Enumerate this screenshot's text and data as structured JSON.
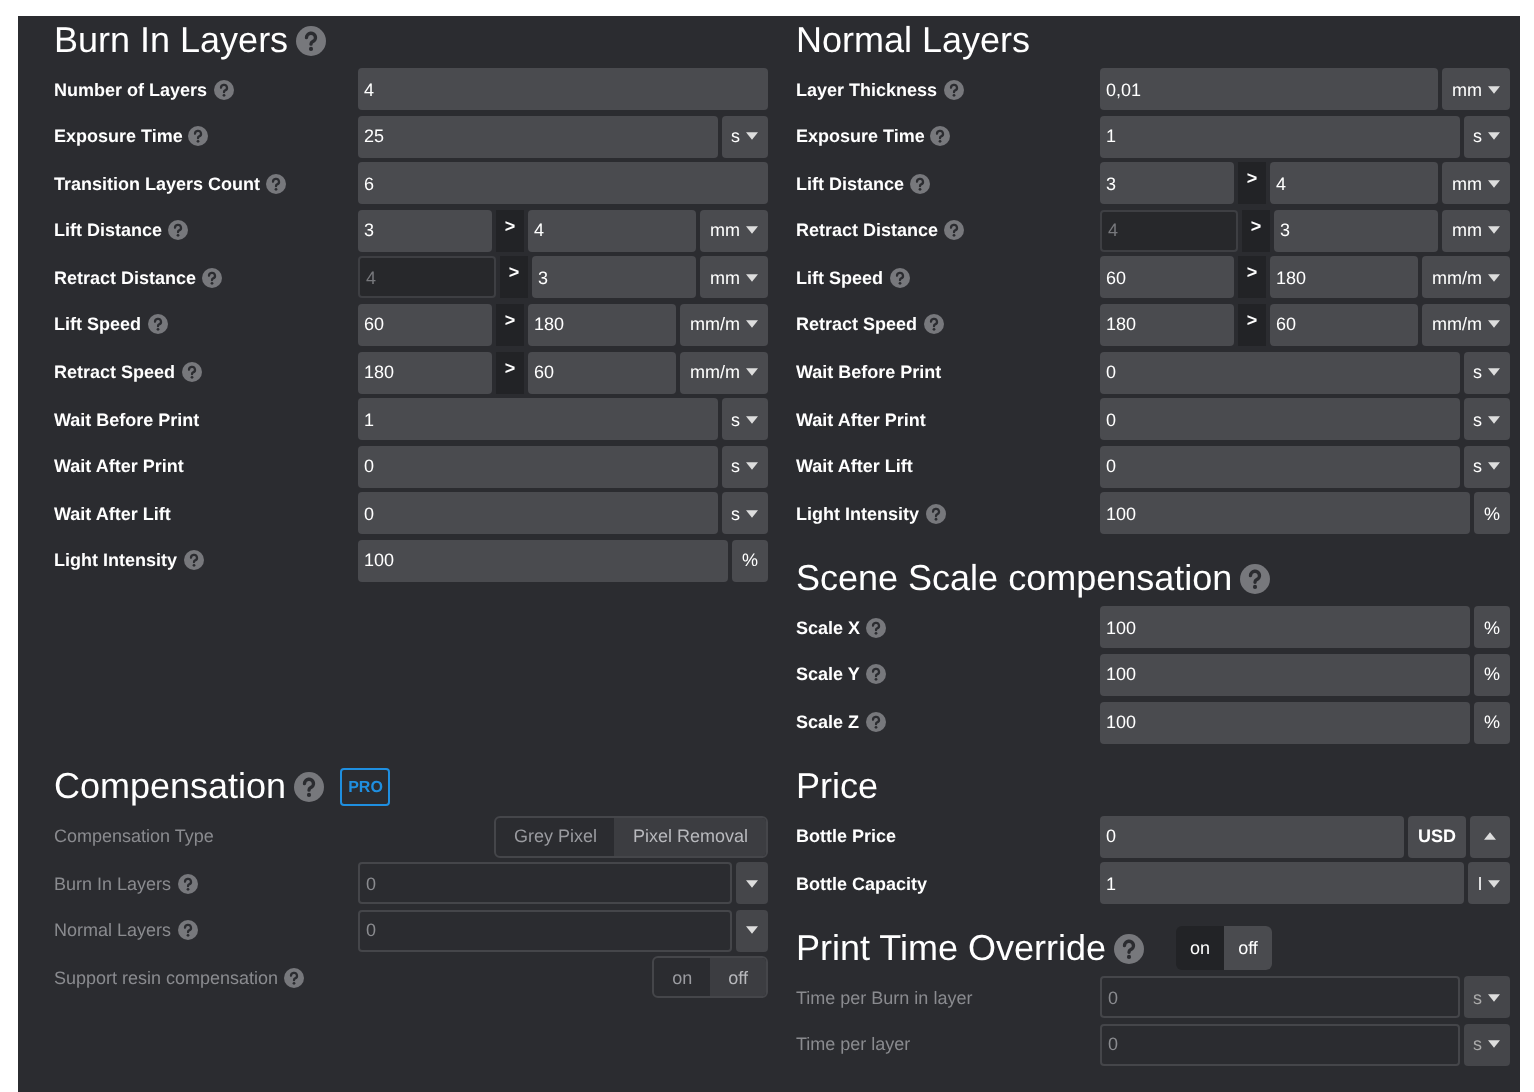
{
  "layout": [
    {
      "left": [
        {
          "title": "Burn In Layers",
          "help": true,
          "rows": [
            {
              "kind": "field",
              "label": "Number of Layers",
              "help": true,
              "value": "4"
            },
            {
              "kind": "field",
              "label": "Exposure Time",
              "help": true,
              "value": "25",
              "unit": "s",
              "unit_menu": true
            },
            {
              "kind": "field",
              "label": "Transition Layers Count",
              "help": true,
              "value": "6"
            },
            {
              "kind": "range",
              "label": "Lift Distance",
              "help": true,
              "from": "3",
              "sep": ">",
              "to": "4",
              "unit": "mm",
              "unit_menu": true
            },
            {
              "kind": "range",
              "label": "Retract Distance",
              "help": true,
              "from": "4",
              "from_disabled": true,
              "sep": ">",
              "to": "3",
              "unit": "mm",
              "unit_menu": true
            },
            {
              "kind": "range",
              "label": "Lift Speed",
              "help": true,
              "from": "60",
              "sep": ">",
              "to": "180",
              "unit": "mm/m",
              "unit_menu": true
            },
            {
              "kind": "range",
              "label": "Retract Speed",
              "help": true,
              "from": "180",
              "sep": ">",
              "to": "60",
              "unit": "mm/m",
              "unit_menu": true
            },
            {
              "kind": "field",
              "label": "Wait Before Print",
              "value": "1",
              "unit": "s",
              "unit_menu": true
            },
            {
              "kind": "field",
              "label": "Wait After Print",
              "value": "0",
              "unit": "s",
              "unit_menu": true
            },
            {
              "kind": "field",
              "label": "Wait After Lift",
              "value": "0",
              "unit": "s",
              "unit_menu": true
            },
            {
              "kind": "field",
              "label": "Light Intensity",
              "help": true,
              "value": "100",
              "unit": "%"
            }
          ]
        }
      ],
      "right": [
        {
          "title": "Normal Layers",
          "rows": [
            {
              "kind": "field",
              "label": "Layer Thickness",
              "help": true,
              "value": "0,01",
              "unit": "mm",
              "unit_menu": true
            },
            {
              "kind": "field",
              "label": "Exposure Time",
              "help": true,
              "value": "1",
              "unit": "s",
              "unit_menu": true
            },
            {
              "kind": "range",
              "label": "Lift Distance",
              "help": true,
              "from": "3",
              "sep": ">",
              "to": "4",
              "unit": "mm",
              "unit_menu": true
            },
            {
              "kind": "range",
              "label": "Retract Distance",
              "help": true,
              "from": "4",
              "from_disabled": true,
              "sep": ">",
              "to": "3",
              "unit": "mm",
              "unit_menu": true
            },
            {
              "kind": "range",
              "label": "Lift Speed",
              "help": true,
              "from": "60",
              "sep": ">",
              "to": "180",
              "unit": "mm/m",
              "unit_menu": true
            },
            {
              "kind": "range",
              "label": "Retract Speed",
              "help": true,
              "from": "180",
              "sep": ">",
              "to": "60",
              "unit": "mm/m",
              "unit_menu": true
            },
            {
              "kind": "field",
              "label": "Wait Before Print",
              "value": "0",
              "unit": "s",
              "unit_menu": true
            },
            {
              "kind": "field",
              "label": "Wait After Print",
              "value": "0",
              "unit": "s",
              "unit_menu": true
            },
            {
              "kind": "field",
              "label": "Wait After Lift",
              "value": "0",
              "unit": "s",
              "unit_menu": true
            },
            {
              "kind": "field",
              "label": "Light Intensity",
              "help": true,
              "value": "100",
              "unit": "%"
            }
          ]
        },
        {
          "title": "Scene Scale compensation",
          "help": true,
          "rows": [
            {
              "kind": "field",
              "label": "Scale X",
              "help": true,
              "value": "100",
              "unit": "%"
            },
            {
              "kind": "field",
              "label": "Scale Y",
              "help": true,
              "value": "100",
              "unit": "%"
            },
            {
              "kind": "field",
              "label": "Scale Z",
              "help": true,
              "value": "100",
              "unit": "%"
            }
          ]
        }
      ]
    },
    {
      "left": [
        {
          "title": "Compensation",
          "help": true,
          "badge": "PRO",
          "rows": [
            {
              "kind": "segmented",
              "label": "Compensation Type",
              "disabled": true,
              "options": [
                {
                  "label": "Grey Pixel",
                  "selected": false
                },
                {
                  "label": "Pixel Removal",
                  "selected": true
                }
              ]
            },
            {
              "kind": "field",
              "label": "Burn In Layers",
              "help": true,
              "disabled": true,
              "value": "0",
              "unit_menu": true
            },
            {
              "kind": "field",
              "label": "Normal Layers",
              "help": true,
              "disabled": true,
              "value": "0",
              "unit_menu": true
            },
            {
              "kind": "switch",
              "label": "Support resin compensation",
              "help": true,
              "disabled": true,
              "options": [
                {
                  "label": "on",
                  "selected": false
                },
                {
                  "label": "off",
                  "selected": true
                }
              ]
            }
          ]
        }
      ],
      "right": [
        {
          "title": "Price",
          "rows": [
            {
              "kind": "field",
              "label": "Bottle Price",
              "value": "0",
              "unit": "USD",
              "spinner": true
            },
            {
              "kind": "field",
              "label": "Bottle Capacity",
              "value": "1",
              "unit": "l",
              "unit_menu": true
            }
          ]
        },
        {
          "title": "Print Time Override",
          "help": true,
          "toggle": [
            {
              "label": "on",
              "selected": false
            },
            {
              "label": "off",
              "selected": true
            }
          ],
          "rows": [
            {
              "kind": "field",
              "label": "Time per Burn in layer",
              "disabled": true,
              "value": "0",
              "unit": "s",
              "unit_menu": true
            },
            {
              "kind": "field",
              "label": "Time per layer",
              "disabled": true,
              "value": "0",
              "unit": "s",
              "unit_menu": true
            }
          ]
        }
      ]
    }
  ]
}
